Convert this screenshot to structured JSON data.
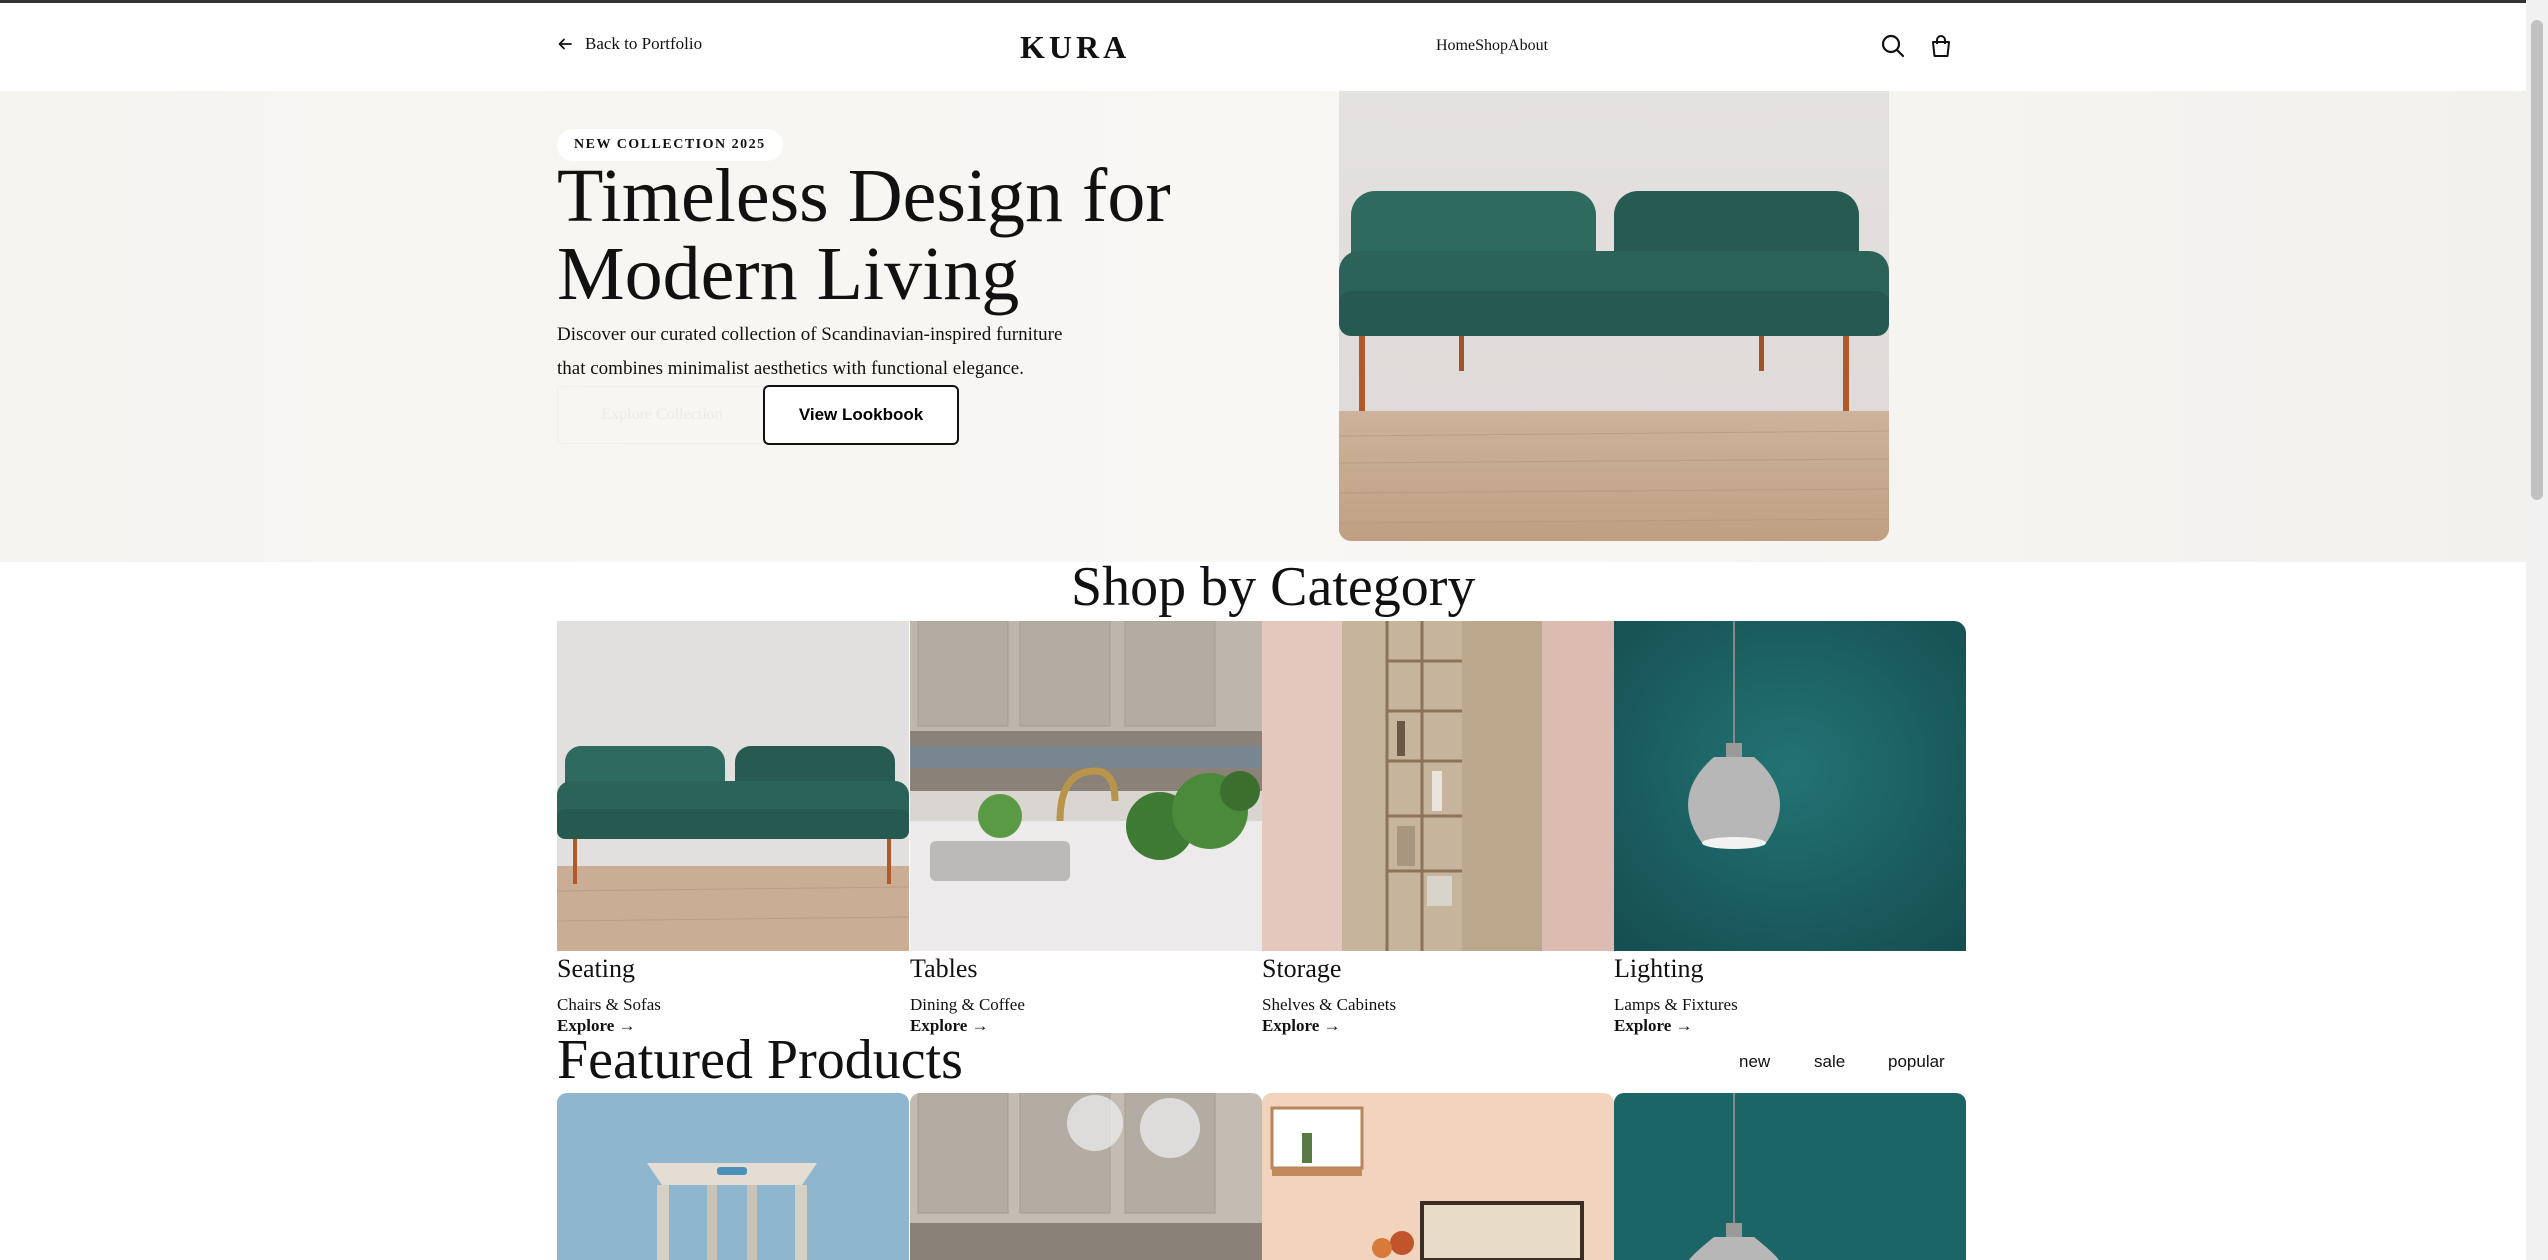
{
  "header": {
    "back_label": "Back to Portfolio",
    "logo": "KURA",
    "nav": [
      "Home",
      "Shop",
      "About"
    ]
  },
  "hero": {
    "badge": "NEW COLLECTION 2025",
    "title_line1": "Timeless Design for",
    "title_line2": "Modern Living",
    "desc_line1": "Discover our curated collection of Scandinavian-inspired furniture",
    "desc_line2": "that combines minimalist aesthetics with functional elegance.",
    "explore_label": "Explore Collection",
    "lookbook_label": "View Lookbook"
  },
  "categories": {
    "title": "Shop by Category",
    "items": [
      {
        "name": "Seating",
        "sub": "Chairs & Sofas",
        "link": "Explore →"
      },
      {
        "name": "Tables",
        "sub": "Dining & Coffee",
        "link": "Explore →"
      },
      {
        "name": "Storage",
        "sub": "Shelves & Cabinets",
        "link": "Explore →"
      },
      {
        "name": "Lighting",
        "sub": "Lamps & Fixtures",
        "link": "Explore →"
      }
    ]
  },
  "featured": {
    "title": "Featured Products",
    "filters": [
      "new",
      "sale",
      "popular"
    ]
  },
  "colors": {
    "hero_bg": "#f7f5f2",
    "sofa": "#2e5e55",
    "lamp_bg": "#1e6b6b",
    "text": "#111111"
  }
}
